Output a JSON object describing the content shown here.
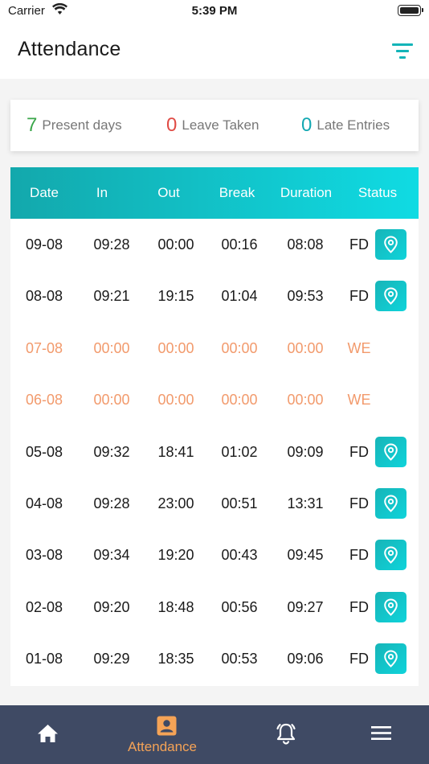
{
  "status_bar": {
    "carrier": "Carrier",
    "time": "5:39 PM"
  },
  "header": {
    "title": "Attendance",
    "filter_icon": "filter-icon"
  },
  "summary": [
    {
      "value": "7",
      "label": "Present days",
      "color": "#3aa64a"
    },
    {
      "value": "0",
      "label": "Leave Taken",
      "color": "#e04b45"
    },
    {
      "value": "0",
      "label": "Late Entries",
      "color": "#13a8b2"
    }
  ],
  "table": {
    "headers": [
      "Date",
      "In",
      "Out",
      "Break",
      "Duration",
      "Status"
    ],
    "rows": [
      {
        "date": "09-08",
        "in": "09:28",
        "out": "00:00",
        "break": "00:16",
        "duration": "08:08",
        "status": "FD",
        "weekend": false
      },
      {
        "date": "08-08",
        "in": "09:21",
        "out": "19:15",
        "break": "01:04",
        "duration": "09:53",
        "status": "FD",
        "weekend": false
      },
      {
        "date": "07-08",
        "in": "00:00",
        "out": "00:00",
        "break": "00:00",
        "duration": "00:00",
        "status": "WE",
        "weekend": true
      },
      {
        "date": "06-08",
        "in": "00:00",
        "out": "00:00",
        "break": "00:00",
        "duration": "00:00",
        "status": "WE",
        "weekend": true
      },
      {
        "date": "05-08",
        "in": "09:32",
        "out": "18:41",
        "break": "01:02",
        "duration": "09:09",
        "status": "FD",
        "weekend": false
      },
      {
        "date": "04-08",
        "in": "09:28",
        "out": "23:00",
        "break": "00:51",
        "duration": "13:31",
        "status": "FD",
        "weekend": false
      },
      {
        "date": "03-08",
        "in": "09:34",
        "out": "19:20",
        "break": "00:43",
        "duration": "09:45",
        "status": "FD",
        "weekend": false
      },
      {
        "date": "02-08",
        "in": "09:20",
        "out": "18:48",
        "break": "00:56",
        "duration": "09:27",
        "status": "FD",
        "weekend": false
      },
      {
        "date": "01-08",
        "in": "09:29",
        "out": "18:35",
        "break": "00:53",
        "duration": "09:06",
        "status": "FD",
        "weekend": false
      }
    ]
  },
  "tabbar": {
    "active_tab": "Attendance",
    "tabs": [
      {
        "icon": "home-icon",
        "label": ""
      },
      {
        "icon": "badge-icon",
        "label": "Attendance"
      },
      {
        "icon": "bell-icon",
        "label": ""
      },
      {
        "icon": "menu-icon",
        "label": ""
      }
    ]
  },
  "colors": {
    "accent": "#13b4b8",
    "weekend_text": "#f29a6c",
    "tabbar_bg": "#3f4a64",
    "tab_active": "#f5a356"
  }
}
